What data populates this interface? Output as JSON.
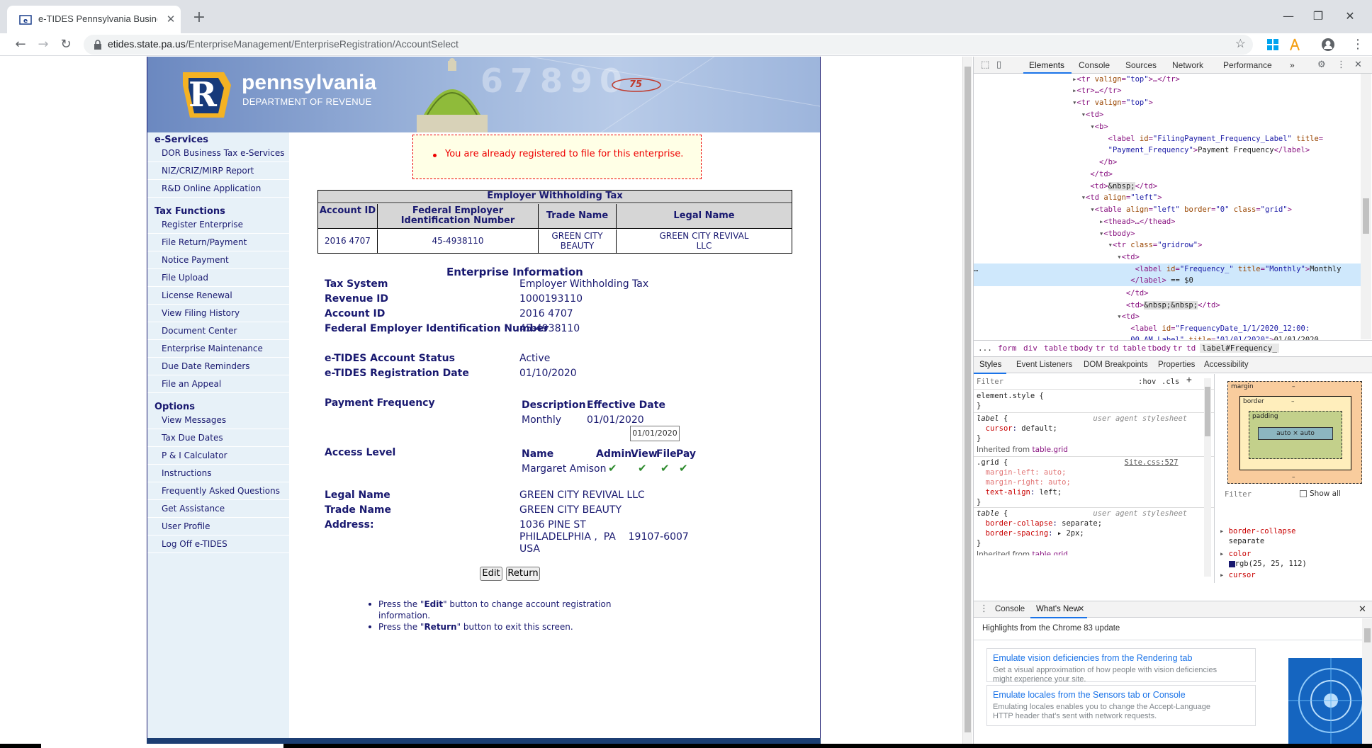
{
  "browser": {
    "tab_title": "e-TIDES Pennsylvania Business Tax",
    "url_host": "etides.state.pa.us",
    "url_path": "/EnterpriseManagement/EnterpriseRegistration/AccountSelect",
    "new_tab_icon": "plus-icon",
    "window_controls": [
      "minimize",
      "maximize",
      "close"
    ]
  },
  "banner": {
    "brand": "pennsylvania",
    "department": "DEPARTMENT OF REVENUE",
    "logo_letter": "R",
    "decor_text": "75"
  },
  "sidebar": {
    "sections": [
      {
        "title": "e-Services",
        "items": [
          "DOR Business Tax e-Services",
          "NIZ/CRIZ/MIRP Report",
          "R&D Online Application"
        ]
      },
      {
        "title": "Tax Functions",
        "items": [
          "Register Enterprise",
          "File Return/Payment",
          "Notice Payment",
          "File Upload",
          "License Renewal",
          "View Filing History",
          "Document Center",
          "Enterprise Maintenance",
          "Due Date Reminders",
          "File an Appeal"
        ]
      },
      {
        "title": "Options",
        "items": [
          "View Messages",
          "Tax Due Dates",
          "P & I Calculator",
          "Instructions",
          "Frequently Asked Questions",
          "Get Assistance",
          "User Profile",
          "Log Off e-TIDES"
        ]
      }
    ]
  },
  "warning": {
    "message": "You are already registered to file for this enterprise."
  },
  "withholding_table": {
    "caption": "Employer Withholding Tax",
    "headers": [
      "Account ID",
      "Federal Employer Identification Number",
      "Trade Name",
      "Legal Name"
    ],
    "row": [
      "2016 4707",
      "45-4938110",
      "GREEN CITY BEAUTY",
      "GREEN CITY REVIVAL LLC"
    ]
  },
  "enterprise": {
    "title": "Enterprise Information",
    "fields": [
      {
        "label": "Tax System",
        "value": "Employer Withholding Tax"
      },
      {
        "label": "Revenue ID",
        "value": "1000193110"
      },
      {
        "label": "Account ID",
        "value": "2016 4707"
      },
      {
        "label": "Federal Employer Identification Number",
        "value": "45-4938110"
      }
    ],
    "status_label": "e-TIDES Account Status",
    "status_value": "Active",
    "regdate_label": "e-TIDES Registration Date",
    "regdate_value": "01/10/2020",
    "payfreq_label": "Payment Frequency",
    "payfreq_headers": [
      "Description",
      "Effective Date"
    ],
    "payfreq_row": [
      "Monthly",
      "01/01/2020"
    ],
    "tooltip": "01/01/2020",
    "access_label": "Access Level",
    "access_headers": [
      "Name",
      "Admin.",
      "View",
      "File",
      "Pay"
    ],
    "access_name": "Margaret Amison",
    "check_icon": "check-icon",
    "legal_label": "Legal Name",
    "legal_value": "GREEN CITY REVIVAL LLC",
    "trade_label": "Trade Name",
    "trade_value": "GREEN CITY BEAUTY",
    "address_label": "Address:",
    "address_lines": [
      "1036 PINE ST",
      "PHILADELPHIA ,  PA    19107-6007",
      "USA"
    ]
  },
  "buttons": {
    "edit": "Edit",
    "return": "Return"
  },
  "instructions": [
    {
      "pre": "Press the \"",
      "bold": "Edit",
      "post": "\" button to change account registration information."
    },
    {
      "pre": "Press the \"",
      "bold": "Return",
      "post": "\" button to exit this screen."
    }
  ],
  "devtools": {
    "tabs": [
      "Elements",
      "Console",
      "Sources",
      "Network",
      "Performance"
    ],
    "more": "»",
    "crumbs": [
      "...",
      "form",
      "div",
      "table",
      "tbody",
      "tr",
      "td",
      "table",
      "tbody",
      "tr",
      "td",
      "label#Frequency_"
    ],
    "style_tabs": [
      "Styles",
      "Event Listeners",
      "DOM Breakpoints",
      "Properties",
      "Accessibility"
    ],
    "filter_placeholder": "Filter",
    "hov": ":hov",
    "cls": ".cls",
    "show_all": "Show all",
    "bm_labels": {
      "margin": "margin",
      "border": "border",
      "padding": "padding",
      "content": "auto × auto",
      "dash": "–"
    },
    "drawer_tabs": [
      "Console",
      "What's New"
    ],
    "whats_new_highlight": "Highlights from the Chrome 83 update",
    "cards": [
      {
        "title": "Emulate vision deficiencies from the Rendering tab",
        "desc": "Get a visual approximation of how people with vision deficiencies might experience your site."
      },
      {
        "title": "Emulate locales from the Sensors tab or Console",
        "desc": "Emulating locales enables you to change the Accept-Language HTTP header that's sent with network requests."
      }
    ]
  }
}
